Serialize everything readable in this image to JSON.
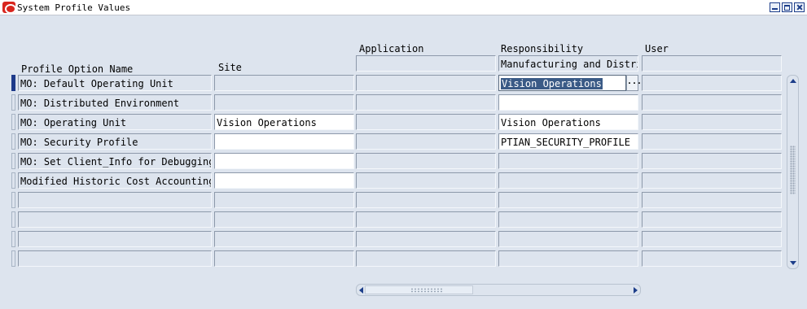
{
  "window": {
    "title": "System Profile Values",
    "controls": [
      "minimize-icon",
      "maximize-icon",
      "close-icon"
    ]
  },
  "headers": {
    "profile_option_name": "Profile Option Name",
    "site": "Site",
    "application": "Application",
    "responsibility": "Responsibility",
    "user": "User"
  },
  "context": {
    "application_value": "",
    "responsibility_value": "Manufacturing and Distri",
    "user_value": ""
  },
  "rows": [
    {
      "name": "MO: Default Operating Unit",
      "site": "",
      "application": "",
      "responsibility": "Vision Operations",
      "user": ""
    },
    {
      "name": "MO: Distributed Environment",
      "site": "",
      "application": "",
      "responsibility": "",
      "user": ""
    },
    {
      "name": "MO: Operating Unit",
      "site": "Vision Operations",
      "application": "",
      "responsibility": "Vision Operations",
      "user": ""
    },
    {
      "name": "MO: Security Profile",
      "site": "",
      "application": "",
      "responsibility": "PTIAN_SECURITY_PROFILE",
      "user": ""
    },
    {
      "name": "MO: Set Client_Info for Debugging",
      "site": "",
      "application": "",
      "responsibility": "",
      "user": ""
    },
    {
      "name": "Modified Historic Cost Accounting",
      "site": "",
      "application": "",
      "responsibility": "",
      "user": ""
    },
    {
      "name": "",
      "site": "",
      "application": "",
      "responsibility": "",
      "user": ""
    },
    {
      "name": "",
      "site": "",
      "application": "",
      "responsibility": "",
      "user": ""
    },
    {
      "name": "",
      "site": "",
      "application": "",
      "responsibility": "",
      "user": ""
    },
    {
      "name": "",
      "site": "",
      "application": "",
      "responsibility": "",
      "user": ""
    }
  ],
  "lov_button_label": "...",
  "colors": {
    "background": "#dde4ee",
    "selection": "#3a5a86",
    "accent": "#1d3e8a",
    "logo": "#d8261e"
  }
}
